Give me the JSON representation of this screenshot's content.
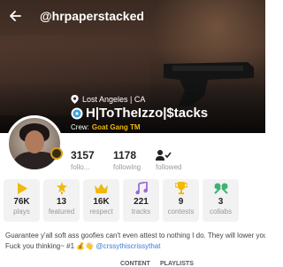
{
  "header": {
    "handle": "@hrpaperstacked"
  },
  "profile": {
    "location": "Lost Angeles | CA",
    "display_name": "H|ToTheIzzo|$tacks",
    "crew_label": "Crew:",
    "crew_value": "Goat Gang TM"
  },
  "stats": {
    "followers_count": "3157",
    "followers_label": "follo...",
    "following_count": "1178",
    "following_label": "following",
    "followed_label": "followed"
  },
  "cards": [
    {
      "icon": "play-icon",
      "value": "76K",
      "label": "plays"
    },
    {
      "icon": "featured-icon",
      "value": "13",
      "label": "featured"
    },
    {
      "icon": "crown-icon",
      "value": "16K",
      "label": "respect"
    },
    {
      "icon": "music-note-icon",
      "value": "221",
      "label": "tracks"
    },
    {
      "icon": "trophy-icon",
      "value": "9",
      "label": "contests"
    },
    {
      "icon": "collab-icon",
      "value": "3",
      "label": "collabs"
    }
  ],
  "bio": {
    "line1": "Guarantee y'all soft ass goofies can't even attest to nothing I do. They will lower you do",
    "line2_prefix": "Fuck you thinking~ #1 💰👋 ",
    "line2_link": "@crssythiscrissythat"
  },
  "tabs": [
    {
      "label": "CONTENT"
    },
    {
      "label": "PLAYLISTS"
    }
  ],
  "colors": {
    "accent": "#f0b90b",
    "link": "#3a7bd5"
  }
}
